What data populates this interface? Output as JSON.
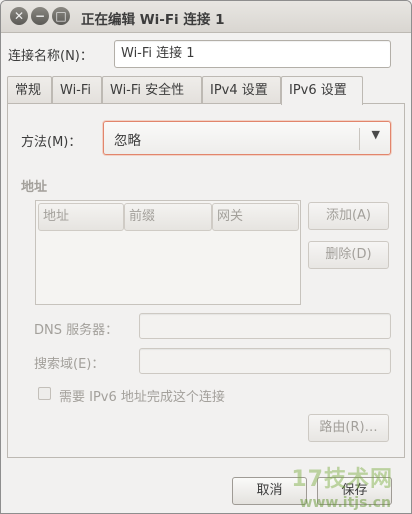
{
  "window": {
    "title": "正在编辑 Wi-Fi 连接 1",
    "close_glyph": "✕",
    "min_glyph": "−",
    "max_glyph": "□"
  },
  "connection_name": {
    "label": "连接名称(N)：",
    "value": "Wi-Fi 连接 1"
  },
  "tabs": [
    {
      "label": "常规"
    },
    {
      "label": "Wi-Fi"
    },
    {
      "label": "Wi-Fi 安全性"
    },
    {
      "label": "IPv4 设置"
    },
    {
      "label": "IPv6 设置",
      "active": true
    }
  ],
  "method": {
    "label": "方法(M)：",
    "value": "忽略",
    "arrow_icon": "▼"
  },
  "addresses": {
    "section_label": "地址",
    "columns": [
      "地址",
      "前缀",
      "网关"
    ],
    "add_button": "添加(A)",
    "delete_button": "删除(D)"
  },
  "dns": {
    "label": "DNS 服务器：",
    "value": ""
  },
  "search_domains": {
    "label": "搜索域(E)：",
    "value": ""
  },
  "require_ipv6": {
    "label": "需要 IPv6 地址完成这个连接",
    "checked": false
  },
  "routes_button": "路由(R)…",
  "footer": {
    "cancel_button": "取消",
    "save_button": "保存"
  },
  "watermark": {
    "text": "17技术网",
    "url": "www.itjs.cn"
  }
}
